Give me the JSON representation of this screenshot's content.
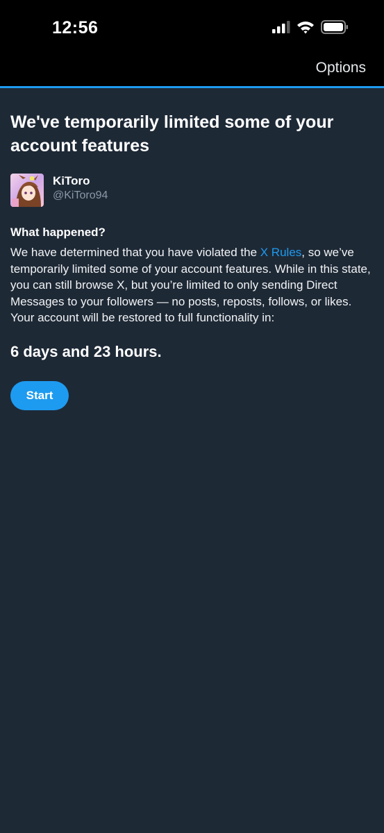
{
  "status_bar": {
    "time": "12:56",
    "icons": [
      "cellular-signal-icon",
      "wifi-icon",
      "battery-icon"
    ]
  },
  "header": {
    "options_label": "Options"
  },
  "notice": {
    "title": "We've temporarily limited some of your account features",
    "account": {
      "display_name": "KiToro",
      "handle": "@KiToro94"
    },
    "section_heading": "What happened?",
    "body_before_link": "We have determined that you have violated the ",
    "rules_link": "X Rules",
    "body_after_link": ", so we’ve temporarily limited some of your account features. While in this state, you can still browse X, but you’re limited to only sending Direct Messages to your followers — no posts, reposts, follows, or likes. Your account will be restored to full functionality in:",
    "duration": "6 days and 23 hours.",
    "start_button": "Start"
  },
  "colors": {
    "background": "#1e2936",
    "top_bar": "#000000",
    "accent": "#1d9bf0",
    "secondary_text": "#8b98a5"
  }
}
